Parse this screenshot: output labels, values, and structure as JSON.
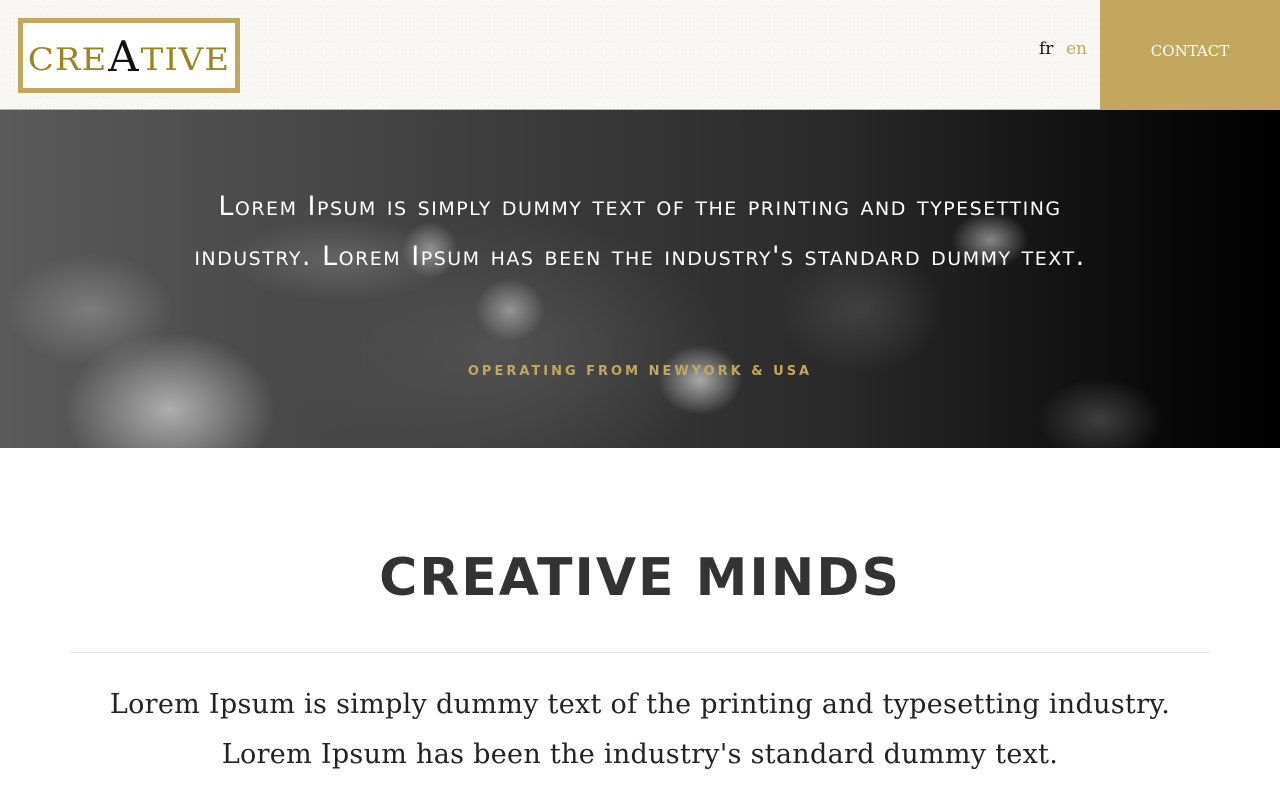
{
  "header": {
    "logo": {
      "text_part1": "CRE",
      "text_accent": "A",
      "text_part2": "TIVE"
    },
    "languages": [
      {
        "label": "fr",
        "active": false
      },
      {
        "label": "en",
        "active": true
      }
    ],
    "contact_label": "CONTACT"
  },
  "hero": {
    "headline": "Lorem Ipsum is simply dummy text of the printing and typesetting industry. Lorem Ipsum has been the industry's standard dummy text.",
    "subtitle": "OPERATING FROM NEWYORK & USA"
  },
  "main": {
    "title": "CREATIVE MINDS",
    "body": "Lorem Ipsum is simply dummy text of the printing and typesetting industry. Lorem Ipsum has been the industry's standard dummy text."
  },
  "colors": {
    "accent_gold": "#c4a75f",
    "logo_gold": "#9a8520",
    "heading_dark": "#333333"
  }
}
